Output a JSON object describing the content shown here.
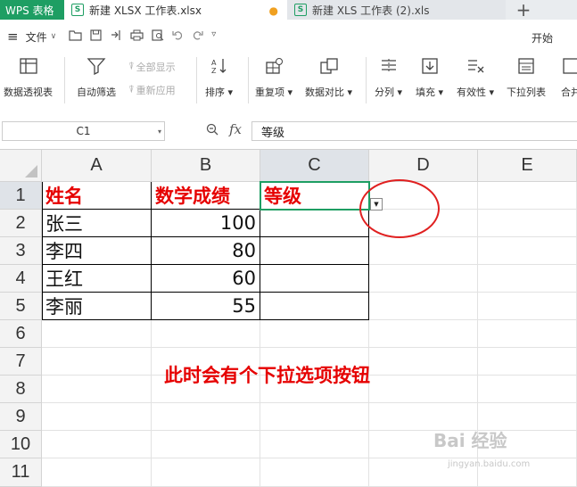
{
  "tabs": {
    "app": "WPS 表格",
    "active_doc": "新建 XLSX 工作表.xlsx",
    "active_doc_icon": "S",
    "inactive_doc": "新建 XLS 工作表 (2).xls",
    "inactive_doc_icon": "S",
    "new_tab": "+"
  },
  "menubar": {
    "file": "文件",
    "start": "开始"
  },
  "ribbon": {
    "pivot": "数据透视表",
    "autofilter": "自动筛选",
    "show_all": "全部显示",
    "reapply": "重新应用",
    "sort": "排序",
    "duplicates": "重复项",
    "compare": "数据对比",
    "split": "分列",
    "fill": "填充",
    "validity": "有效性",
    "dropdown_list": "下拉列表",
    "merge": "合并"
  },
  "formula_bar": {
    "name_box": "C1",
    "fx": "fx",
    "content": "等级"
  },
  "columns": [
    "A",
    "B",
    "C",
    "D",
    "E"
  ],
  "rows": [
    "1",
    "2",
    "3",
    "4",
    "5",
    "6",
    "7",
    "8",
    "9",
    "10",
    "11"
  ],
  "table": {
    "header": [
      "姓名",
      "数学成绩",
      "等级"
    ],
    "rows": [
      [
        "张三",
        "100",
        ""
      ],
      [
        "李四",
        "80",
        ""
      ],
      [
        "王红",
        "60",
        ""
      ],
      [
        "李丽",
        "55",
        ""
      ]
    ]
  },
  "annotation": "此时会有个下拉选项按钮",
  "watermark": {
    "logo": "Bai 经验",
    "url": "jingyan.baidu.com"
  },
  "colors": {
    "accent_green": "#1e9e63",
    "annotation_red": "#e60000"
  }
}
